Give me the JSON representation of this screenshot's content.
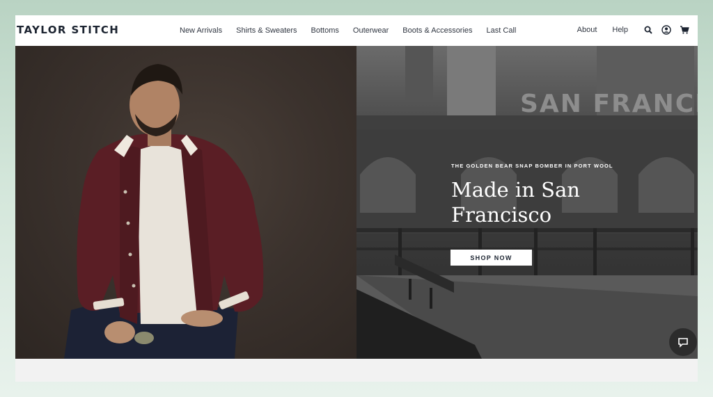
{
  "brand": {
    "name": "TAYLOR STITCH"
  },
  "nav": {
    "items": [
      {
        "label": "New Arrivals"
      },
      {
        "label": "Shirts & Sweaters"
      },
      {
        "label": "Bottoms"
      },
      {
        "label": "Outerwear"
      },
      {
        "label": "Boots & Accessories"
      },
      {
        "label": "Last Call"
      }
    ]
  },
  "utility": {
    "about": "About",
    "help": "Help",
    "icons": [
      "search-icon",
      "account-icon",
      "cart-icon"
    ]
  },
  "hero": {
    "eyebrow": "THE GOLDEN BEAR SNAP BOMBER IN PORT WOOL",
    "headline": "Made in San Francisco",
    "cta": "SHOP NOW",
    "sign_text": "SAN FRANCIS",
    "slides": {
      "count": 5,
      "active": 1
    }
  },
  "colors": {
    "brand_text": "#1b2330",
    "accent_maroon": "#5e1f26"
  }
}
